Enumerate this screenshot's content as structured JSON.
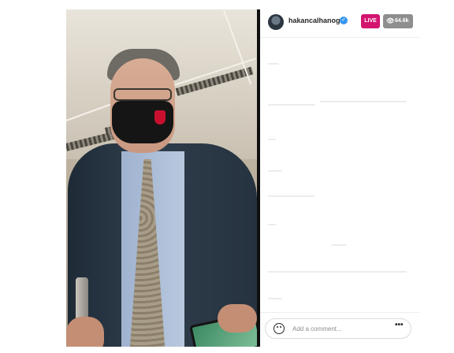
{
  "header": {
    "username": "hakancalhanoglu",
    "verified_icon": "check-icon",
    "live_label": "LIVE",
    "viewer_icon": "eye-icon",
    "viewer_count": "64.6k"
  },
  "comment_bar": {
    "emoji_icon": "emoji-icon",
    "placeholder": "Add a comment...",
    "more_icon": "more-icon",
    "more_label": "•••"
  },
  "colors": {
    "live_badge": "#d3156f",
    "viewer_badge": "#8e8e8e",
    "verified": "#3897f0"
  }
}
